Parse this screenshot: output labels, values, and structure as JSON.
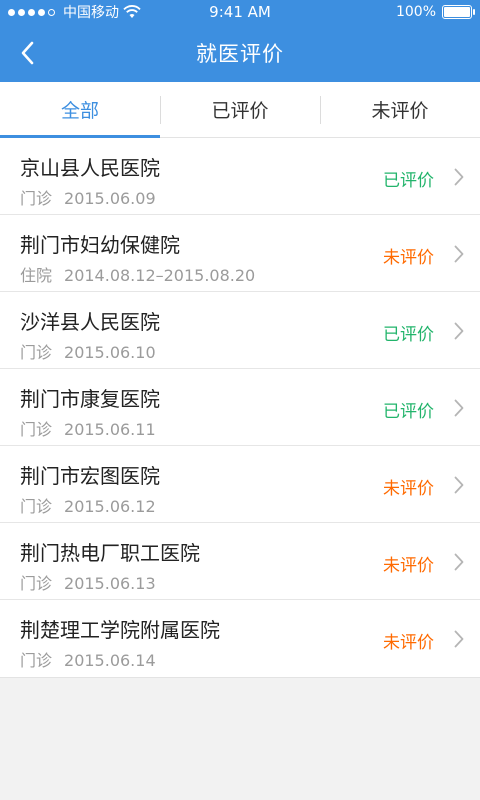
{
  "status_bar": {
    "carrier": "中国移动",
    "time": "9:41 AM",
    "battery": "100%"
  },
  "header": {
    "title": "就医评价",
    "back_icon": "chevron-left-icon"
  },
  "tabs": [
    {
      "label": "全部",
      "active": true
    },
    {
      "label": "已评价",
      "active": false
    },
    {
      "label": "未评价",
      "active": false
    }
  ],
  "colors": {
    "primary": "#3d8fe0",
    "evaluated": "#22b46b",
    "not_evaluated": "#ff6a00"
  },
  "records": [
    {
      "hospital": "京山县人民医院",
      "type": "门诊",
      "date": "2015.06.09",
      "status": "已评价",
      "state": "evaluated"
    },
    {
      "hospital": "荆门市妇幼保健院",
      "type": "住院",
      "date": "2014.08.12–2015.08.20",
      "status": "未评价",
      "state": "pending"
    },
    {
      "hospital": "沙洋县人民医院",
      "type": "门诊",
      "date": "2015.06.10",
      "status": "已评价",
      "state": "evaluated"
    },
    {
      "hospital": "荆门市康复医院",
      "type": "门诊",
      "date": "2015.06.11",
      "status": "已评价",
      "state": "evaluated"
    },
    {
      "hospital": "荆门市宏图医院",
      "type": "门诊",
      "date": "2015.06.12",
      "status": "未评价",
      "state": "pending"
    },
    {
      "hospital": "荆门热电厂职工医院",
      "type": "门诊",
      "date": "2015.06.13",
      "status": "未评价",
      "state": "pending"
    },
    {
      "hospital": "荆楚理工学院附属医院",
      "type": "门诊",
      "date": "2015.06.14",
      "status": "未评价",
      "state": "pending"
    }
  ]
}
